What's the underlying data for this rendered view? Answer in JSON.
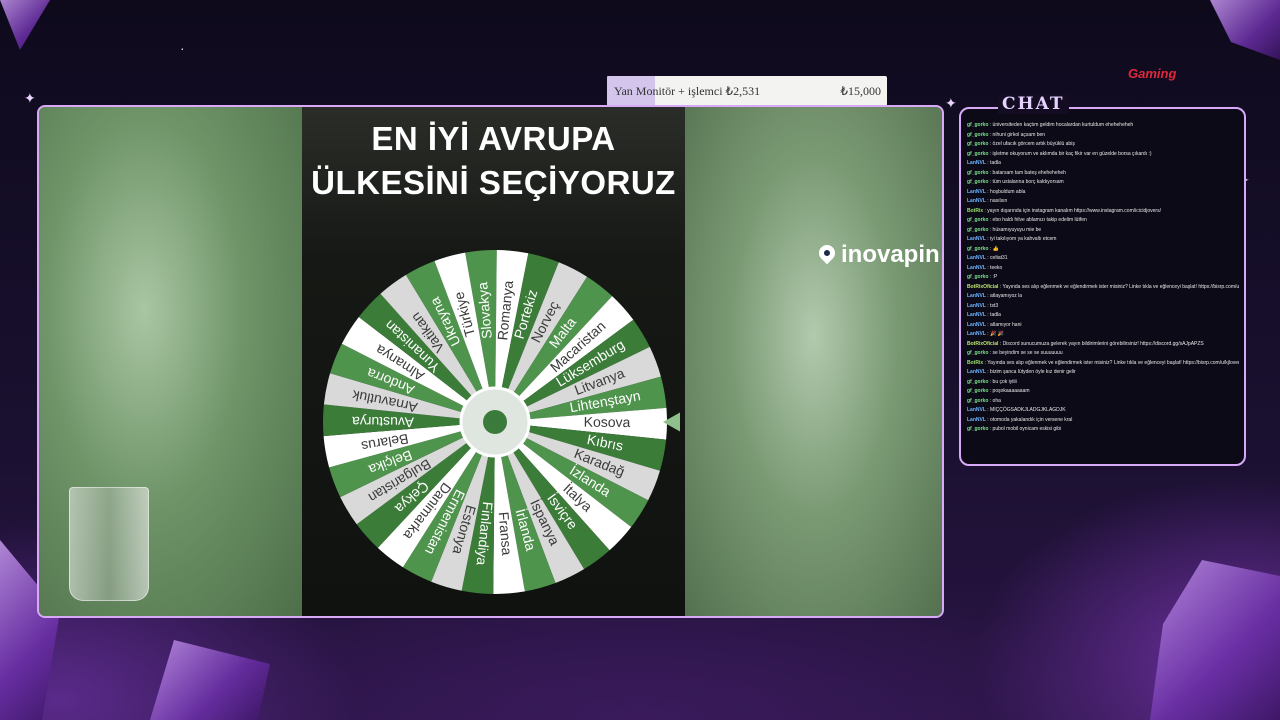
{
  "video": {
    "title_line1": "EN İYİ AVRUPA",
    "title_line2": "ÜLKESİNİ SEÇİYORUZ",
    "sponsor_logo": "inovapin",
    "wheel_labels": [
      "Slovakya",
      "Romanya",
      "Portekiz",
      "Norveç",
      "Malta",
      "Macaristan",
      "Lüksemburg",
      "Litvanya",
      "Lihtenştayn",
      "Kosova",
      "Kıbrıs",
      "Karadağ",
      "İzlanda",
      "İtalya",
      "İsviçre",
      "İspanya",
      "İrlanda",
      "Fransa",
      "Finlandiya",
      "Estonya",
      "Ermenistan",
      "Danimarka",
      "Çekya",
      "Bulgaristan",
      "Belçika",
      "Belarus",
      "Avusturya",
      "Arnavutluk",
      "Andorra",
      "Almanya",
      "Yunanistan",
      "Vatikan",
      "Ukrayna",
      "Türkiye"
    ]
  },
  "price_overlay": {
    "name": "Yan Monitör + işlemci ₺2,531",
    "value": "₺15,000"
  },
  "brand": "Gaming",
  "chat": {
    "title": "CHAT",
    "messages": [
      {
        "user": "gf_gorko",
        "color": "#7ce38b",
        "text": "üniversiteden kaçtım geldim hocalardan kurtuldum eheheheheh"
      },
      {
        "user": "gf_gorko",
        "color": "#7ce38b",
        "text": "nihuni girkol açsam ben"
      },
      {
        "user": "gf_gorko",
        "color": "#7ce38b",
        "text": "özel ufacık görcem artık büyüklü abiş"
      },
      {
        "user": "gf_gorko",
        "color": "#7ce38b",
        "text": "işletme okuyorum ve aklımda bir kaç fikir var en güzelde borsa çıkardı :)"
      },
      {
        "user": "LanNVL",
        "color": "#6fb6ff",
        "text": "tadla"
      },
      {
        "user": "gf_gorko",
        "color": "#7ce38b",
        "text": "batarsam tam bateş eheheheheh"
      },
      {
        "user": "gf_gorko",
        "color": "#7ce38b",
        "text": "tüm ustalarına borç kaldıyorsam"
      },
      {
        "user": "LanNVL",
        "color": "#6fb6ff",
        "text": "hoşbuldum abla"
      },
      {
        "user": "LanNVL",
        "color": "#6fb6ff",
        "text": "nasılsın"
      },
      {
        "user": "BotRix",
        "color": "#9be36f",
        "text": "yayın dışarında için instagram kanalım https://www.instagram.com/icicidjovers/"
      },
      {
        "user": "gf_gorko",
        "color": "#7ce38b",
        "text": "ebo haldı hilve ablamızı takip edelim lütfen"
      },
      {
        "user": "gf_gorko",
        "color": "#7ce38b",
        "text": "hüsamıyuyuyu mie be"
      },
      {
        "user": "LanNVL",
        "color": "#6fb6ff",
        "text": "iyi takılıyom ya kahvaltı etcem"
      },
      {
        "user": "gf_gorko",
        "color": "#7ce38b",
        "text": "👍"
      },
      {
        "user": "LanNVL",
        "color": "#6fb6ff",
        "text": "celtat31"
      },
      {
        "user": "LanNVL",
        "color": "#6fb6ff",
        "text": "teeko"
      },
      {
        "user": "gf_gorko",
        "color": "#7ce38b",
        "text": ":P"
      },
      {
        "user": "BotRixOficial",
        "color": "#b9e36f",
        "text": "Yayında ses alıp eğlenmek ve eğlendirmek ister misiniz? Linke tıkla ve eğlenceyi başlat! https://bisrp.com/u/kjlovers"
      },
      {
        "user": "LanNVL",
        "color": "#6fb6ff",
        "text": "atlayamıyoz la"
      },
      {
        "user": "LanNVL",
        "color": "#6fb6ff",
        "text": "tst3"
      },
      {
        "user": "LanNVL",
        "color": "#6fb6ff",
        "text": "tadla"
      },
      {
        "user": "LanNVL",
        "color": "#6fb6ff",
        "text": "atlamıyor hani"
      },
      {
        "user": "LanNVL",
        "color": "#6fb6ff",
        "text": "🎉 🎉"
      },
      {
        "user": "BotRixOficial",
        "color": "#b9e36f",
        "text": "Discord sunucumuza gelerek yayın bildirimlerini görebilirsiniz! https://discord.gg/sAJpAPZS"
      },
      {
        "user": "gf_gorko",
        "color": "#7ce38b",
        "text": "se beyindim se se se suuuuuuu"
      },
      {
        "user": "BotRix",
        "color": "#9be36f",
        "text": "Yayında ses alıp eğlenmek ve eğlendirmek ister misiniz? Linke tıkla ve eğlenceyi başlat! https://bisrp.com/u/kjlovers"
      },
      {
        "user": "LanNVL",
        "color": "#6fb6ff",
        "text": "bizim şanca lütyden öyle kız denir gelir"
      },
      {
        "user": "gf_gorko",
        "color": "#7ce38b",
        "text": "bu çok iyiiii"
      },
      {
        "user": "gf_gorko",
        "color": "#7ce38b",
        "text": "poşokaaaaaaam"
      },
      {
        "user": "gf_gorko",
        "color": "#7ce38b",
        "text": "oha"
      },
      {
        "user": "LanNVL",
        "color": "#6fb6ff",
        "text": "MIÇÇÖGSADKJLADGJKLAGDJK"
      },
      {
        "user": "LanNVL",
        "color": "#6fb6ff",
        "text": "otomoda yakalandık için versene kral"
      },
      {
        "user": "gf_gorko",
        "color": "#7ce38b",
        "text": "pubol mobil oynicam eskisi gibi"
      }
    ]
  }
}
